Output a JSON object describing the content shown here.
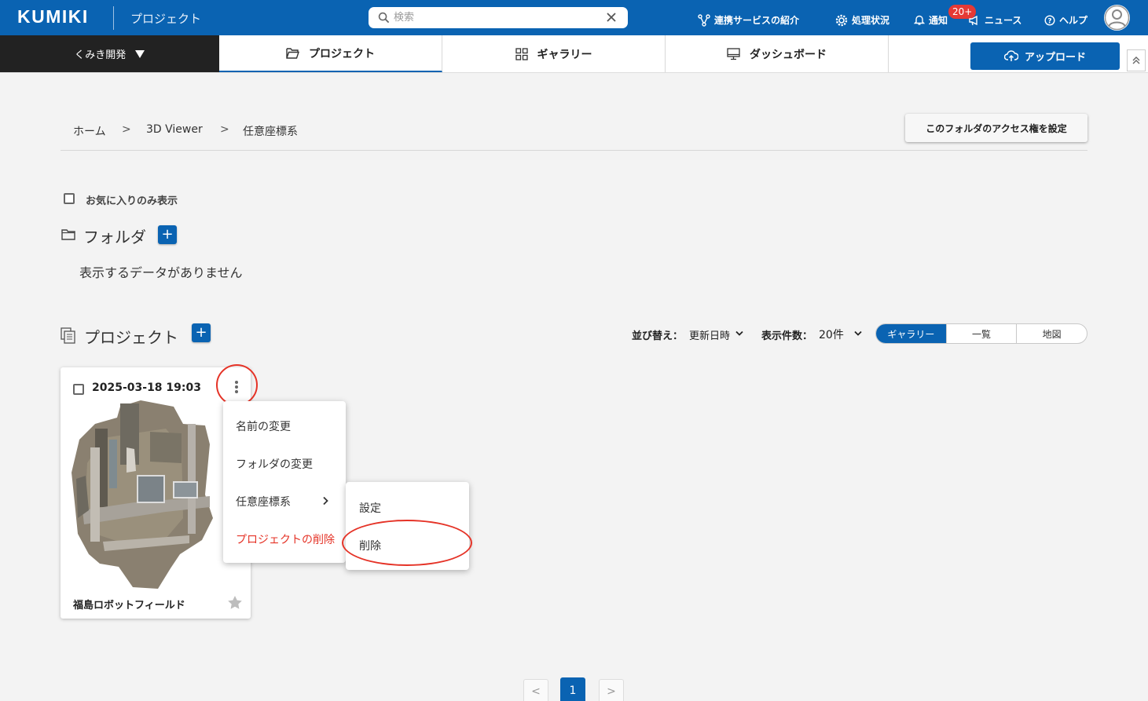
{
  "header": {
    "logo": "KUMIKI",
    "app_title": "プロジェクト",
    "search_placeholder": "検索",
    "links": {
      "services": "連携サービスの紹介",
      "status": "処理状況",
      "notify": "通知",
      "news": "ニュース",
      "help": "ヘルプ"
    },
    "notify_badge": "20+"
  },
  "nav": {
    "team": "くみき開発",
    "tabs": [
      "プロジェクト",
      "ギャラリー",
      "ダッシュボード"
    ],
    "upload": "アップロード"
  },
  "breadcrumb": [
    "ホーム",
    "3D Viewer",
    "任意座標系"
  ],
  "breadcrumb_sep": ">",
  "access_button": "このフォルダのアクセス権を設定",
  "favorites_only": "お気に入りのみ表示",
  "folder_section": {
    "title": "フォルダ",
    "empty": "表示するデータがありません"
  },
  "project_section": {
    "title": "プロジェクト",
    "sort_label": "並び替え：",
    "sort_value": "更新日時",
    "count_label": "表示件数：",
    "count_value": "20件",
    "views": [
      "ギャラリー",
      "一覧",
      "地図"
    ]
  },
  "card": {
    "date": "2025-03-18 19:03",
    "name": "福島ロボットフィールド"
  },
  "context_menu": {
    "items": [
      "名前の変更",
      "フォルダの変更",
      "任意座標系",
      "プロジェクトの削除"
    ],
    "submenu": [
      "設定",
      "削除"
    ]
  },
  "pagination": {
    "prev": "<",
    "current": "1",
    "next": ">"
  },
  "colors": {
    "brand": "#0a63b2",
    "danger": "#e53327",
    "badge": "#e53935"
  }
}
